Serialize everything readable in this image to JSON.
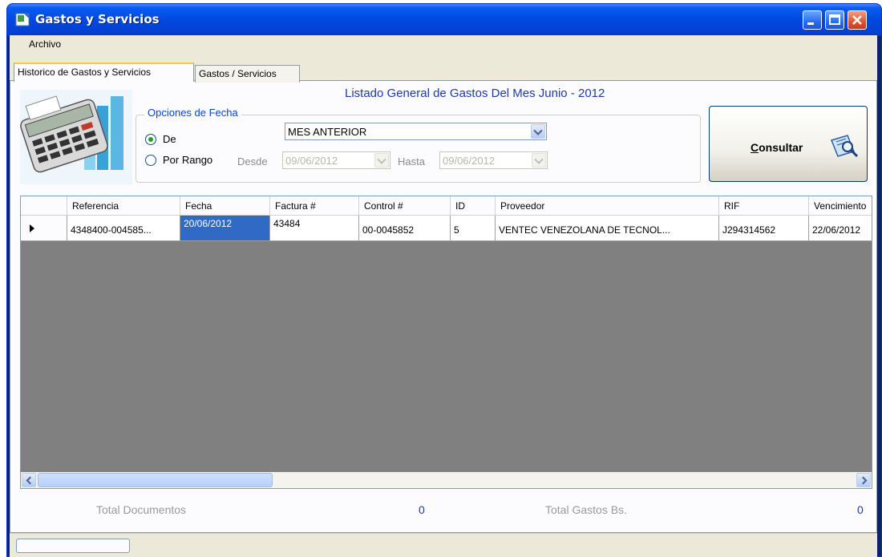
{
  "window": {
    "title": "Gastos y Servicios"
  },
  "menu": {
    "archivo": "Archivo"
  },
  "tabs": [
    {
      "label": "Historico de Gastos y Servicios"
    },
    {
      "label": "Gastos / Servicios"
    }
  ],
  "listado_title": "Listado General de Gastos Del Mes Junio - 2012",
  "fecha_options": {
    "legend": "Opciones de Fecha",
    "de_label": "De",
    "rango_label": "Por Rango",
    "mes_value": "MES ANTERIOR",
    "desde_label": "Desde",
    "desde_value": "09/06/2012",
    "hasta_label": "Hasta",
    "hasta_value": "09/06/2012"
  },
  "consultar_button": {
    "label_rest": "onsultar",
    "label_key": "C"
  },
  "grid": {
    "columns": [
      "Referencia",
      "Fecha",
      "Factura #",
      "Control #",
      "ID",
      "Proveedor",
      "RIF",
      "Vencimiento"
    ],
    "rows": [
      [
        "4348400-004585...",
        "20/06/2012",
        "43484",
        "00-0045852",
        "5",
        "VENTEC VENEZOLANA DE TECNOL...",
        "J294314562",
        "22/06/2012"
      ]
    ]
  },
  "totals": {
    "documentos_label": "Total Documentos",
    "documentos_value": "0",
    "gastos_label": "Total Gastos Bs.",
    "gastos_value": "0"
  },
  "colors": {
    "accent": "#316ac5",
    "title_blue": "#1f3aa8",
    "grid_bg": "#808080"
  },
  "icons": [
    "app-icon",
    "minimize-icon",
    "maximize-icon",
    "close-icon",
    "calculator-icon",
    "search-document-icon",
    "row-pointer-icon",
    "chevron-down-icon",
    "scroll-left-icon",
    "scroll-right-icon"
  ]
}
